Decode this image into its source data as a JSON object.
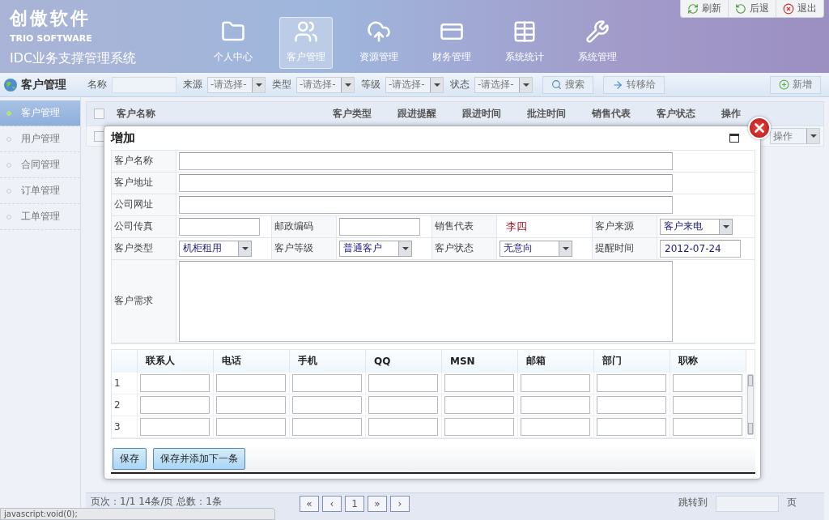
{
  "app": {
    "logo_cn": "创傲软件",
    "logo_en": "TRIO SOFTWARE",
    "system_name": "IDC业务支撑管理系统"
  },
  "top_buttons": [
    {
      "label": "刷新"
    },
    {
      "label": "后退"
    },
    {
      "label": "退出"
    }
  ],
  "nav": [
    {
      "label": "个人中心",
      "selected": false
    },
    {
      "label": "客户管理",
      "selected": true
    },
    {
      "label": "资源管理",
      "selected": false
    },
    {
      "label": "财务管理",
      "selected": false
    },
    {
      "label": "系统统计",
      "selected": false
    },
    {
      "label": "系统管理",
      "selected": false
    }
  ],
  "toolbar": {
    "title": "客户管理",
    "filters": [
      {
        "label": "名称",
        "kind": "text"
      },
      {
        "label": "来源",
        "kind": "select",
        "value": "-请选择-"
      },
      {
        "label": "类型",
        "kind": "select",
        "value": "-请选择-"
      },
      {
        "label": "等级",
        "kind": "select",
        "value": "-请选择-"
      },
      {
        "label": "状态",
        "kind": "select",
        "value": "-请选择-"
      }
    ],
    "search": "搜索",
    "transfer": "转移给",
    "add": "新增"
  },
  "sidebar": [
    {
      "label": "客户管理",
      "selected": true
    },
    {
      "label": "用户管理",
      "selected": false
    },
    {
      "label": "合同管理",
      "selected": false
    },
    {
      "label": "订单管理",
      "selected": false
    },
    {
      "label": "工单管理",
      "selected": false
    }
  ],
  "table": {
    "columns": [
      "客户名称",
      "客户类型",
      "跟进提醒",
      "跟进时间",
      "批注时间",
      "销售代表",
      "客户状态",
      "操作"
    ],
    "row_action": "操作",
    "header_checked": false,
    "row_checked": false
  },
  "dialog": {
    "title": "增加",
    "rows": [
      {
        "cells": [
          {
            "label": "客户名称",
            "kind": "wide"
          }
        ]
      },
      {
        "cells": [
          {
            "label": "客户地址",
            "kind": "wide"
          }
        ]
      },
      {
        "cells": [
          {
            "label": "公司网址",
            "kind": "wide"
          }
        ]
      },
      {
        "cells": [
          {
            "label": "公司传真",
            "kind": "text"
          },
          {
            "label": "邮政编码",
            "kind": "text"
          },
          {
            "label": "销售代表",
            "kind": "static",
            "value": "李四"
          },
          {
            "label": "客户来源",
            "kind": "select",
            "value": "客户来电"
          }
        ]
      },
      {
        "cells": [
          {
            "label": "客户类型",
            "kind": "select",
            "value": "机柜租用"
          },
          {
            "label": "客户等级",
            "kind": "select",
            "value": "普通客户"
          },
          {
            "label": "客户状态",
            "kind": "select",
            "value": "无意向"
          },
          {
            "label": "提醒时间",
            "kind": "text",
            "value": "2012-07-24"
          }
        ]
      },
      {
        "cells": [
          {
            "label": "客户需求",
            "kind": "textarea"
          }
        ]
      }
    ],
    "contacts": {
      "columns": [
        "联系人",
        "电话",
        "手机",
        "QQ",
        "MSN",
        "邮箱",
        "部门",
        "职称"
      ],
      "rows": [
        "1",
        "2",
        "3"
      ]
    },
    "buttons": [
      "保存",
      "保存并添加下一条"
    ]
  },
  "pagination": {
    "info": "页次：1/1  14条/页  总数：1条",
    "pages": [
      "«",
      "‹",
      "1",
      "»",
      "›"
    ],
    "jump_label": "跳转到",
    "page_unit": "页"
  },
  "status_bar": "javascript:void(0);"
}
